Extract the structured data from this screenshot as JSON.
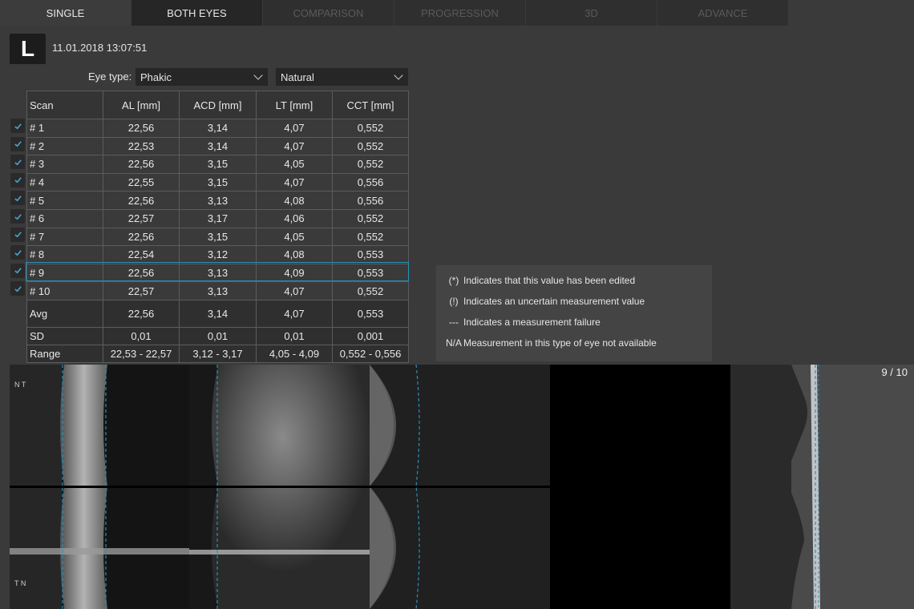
{
  "tabs": [
    {
      "label": "SINGLE",
      "state": "active"
    },
    {
      "label": "BOTH EYES",
      "state": "enabled"
    },
    {
      "label": "COMPARISON",
      "state": "disabled"
    },
    {
      "label": "PROGRESSION",
      "state": "disabled"
    },
    {
      "label": "3D",
      "state": "disabled"
    },
    {
      "label": "ADVANCE",
      "state": "disabled"
    }
  ],
  "eye": "L",
  "datetime": "11.01.2018 13:07:51",
  "eye_type_label": "Eye type:",
  "eye_type_value": "Phakic",
  "lens_value": "Natural",
  "table": {
    "headers": [
      "Scan",
      "AL [mm]",
      "ACD [mm]",
      "LT [mm]",
      "CCT [mm]"
    ],
    "rows": [
      [
        "# 1",
        "22,56",
        "3,14",
        "4,07",
        "0,552"
      ],
      [
        "# 2",
        "22,53",
        "3,14",
        "4,07",
        "0,552"
      ],
      [
        "# 3",
        "22,56",
        "3,15",
        "4,05",
        "0,552"
      ],
      [
        "# 4",
        "22,55",
        "3,15",
        "4,07",
        "0,556"
      ],
      [
        "# 5",
        "22,56",
        "3,13",
        "4,08",
        "0,556"
      ],
      [
        "# 6",
        "22,57",
        "3,17",
        "4,06",
        "0,552"
      ],
      [
        "# 7",
        "22,56",
        "3,15",
        "4,05",
        "0,552"
      ],
      [
        "# 8",
        "22,54",
        "3,12",
        "4,08",
        "0,553"
      ],
      [
        "# 9",
        "22,56",
        "3,13",
        "4,09",
        "0,553"
      ],
      [
        "# 10",
        "22,57",
        "3,13",
        "4,07",
        "0,552"
      ]
    ],
    "selected_row": 9,
    "avg": [
      "Avg",
      "22,56",
      "3,14",
      "4,07",
      "0,553"
    ],
    "sd": [
      "SD",
      "0,01",
      "0,01",
      "0,01",
      "0,001"
    ],
    "range": [
      "Range",
      "22,53 - 22,57",
      "3,12 - 3,17",
      "4,05 - 4,09",
      "0,552 - 0,556"
    ]
  },
  "legend": [
    {
      "symbol": "(*)",
      "text": "Indicates that this value has been edited"
    },
    {
      "symbol": "(!)",
      "text": "Indicates an uncertain measurement value"
    },
    {
      "symbol": "---",
      "text": "Indicates a measurement failure"
    },
    {
      "symbol": "N/A",
      "text": "Measurement in this type of eye not available"
    }
  ],
  "image_counter": "9 / 10",
  "orientation_labels": {
    "top": "N T",
    "bottom": "T N"
  },
  "colors": {
    "accent": "#2b8fb8",
    "check": "#4aa3c8",
    "background": "#3a3a3a"
  }
}
